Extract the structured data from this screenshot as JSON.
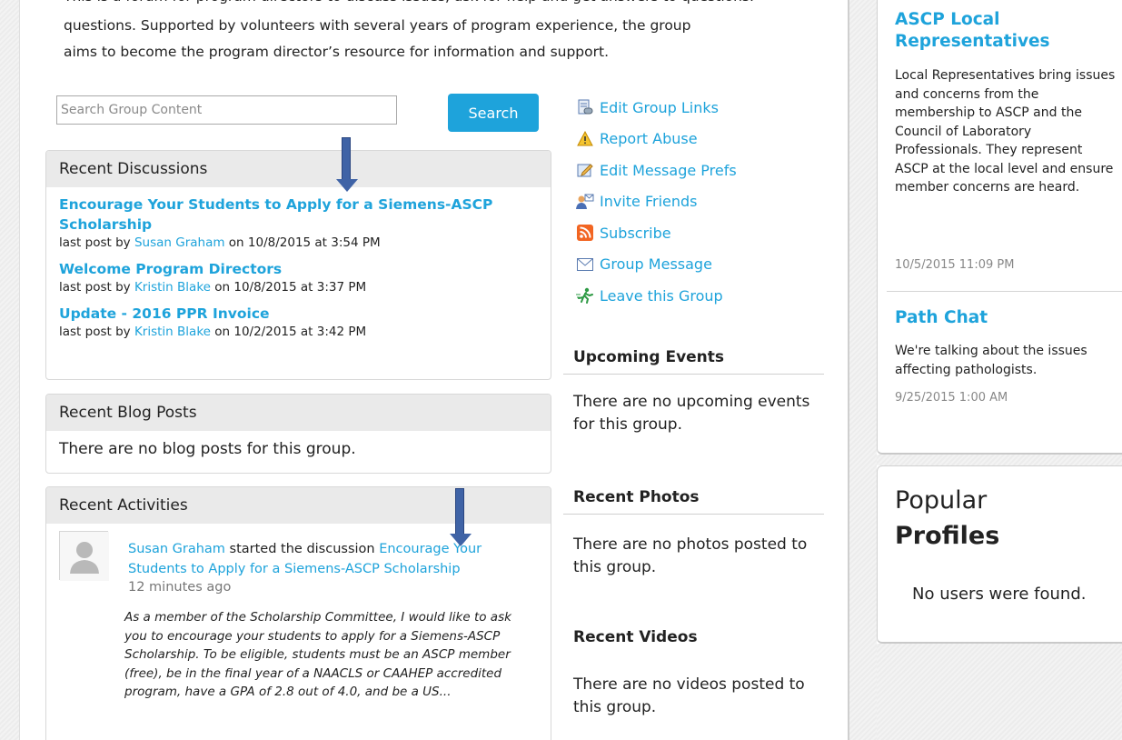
{
  "intro": {
    "clipped_line": "This is a forum for program directors to discuss issues, ask for help and get answers to questions.",
    "line1": "questions. Supported by volunteers with several years of program experience, the group",
    "line2": "aims to become the program director’s resource for information and support."
  },
  "search": {
    "placeholder": "Search Group Content",
    "button_label": "Search"
  },
  "discussions": {
    "title": "Recent Discussions",
    "items": [
      {
        "title": "Encourage Your Students to Apply for a Siemens-ASCP Scholarship",
        "prefix": "last post by ",
        "author": "Susan Graham",
        "suffix": " on 10/8/2015 at 3:54 PM"
      },
      {
        "title": "Welcome Program Directors",
        "prefix": "last post by ",
        "author": "Kristin Blake",
        "suffix": " on 10/8/2015 at 3:37 PM"
      },
      {
        "title": "Update - 2016 PPR Invoice",
        "prefix": "last post by ",
        "author": "Kristin Blake",
        "suffix": " on 10/2/2015 at 3:42 PM"
      }
    ]
  },
  "blog": {
    "title": "Recent Blog Posts",
    "empty": "There are no blog posts for this group."
  },
  "activities": {
    "title": "Recent Activities",
    "actor": "Susan Graham",
    "verb": " started the discussion ",
    "target": "Encourage Your Students to Apply for a Siemens-ASCP Scholarship",
    "time": "12 minutes ago",
    "quote": "As a member of the Scholarship Committee, I would like to ask you to encourage your students to apply for a Siemens-ASCP Scholarship. To be eligible, students must be an ASCP member (free), be in the final year of a NAACLS or CAAHEP accredited program, have a GPA of 2.8 out of 4.0, and be a US..."
  },
  "group_links": [
    {
      "label": "Edit Group Links",
      "icon": "edit-links-icon"
    },
    {
      "label": "Report Abuse",
      "icon": "warning-icon"
    },
    {
      "label": "Edit Message Prefs",
      "icon": "edit-prefs-icon"
    },
    {
      "label": "Invite Friends",
      "icon": "invite-friends-icon"
    },
    {
      "label": "Subscribe",
      "icon": "rss-icon"
    },
    {
      "label": "Group Message",
      "icon": "envelope-icon"
    },
    {
      "label": "Leave this Group",
      "icon": "leave-icon"
    }
  ],
  "events": {
    "title": "Upcoming Events",
    "empty": "There are no upcoming events for this group."
  },
  "photos": {
    "title": "Recent Photos",
    "empty": "There are no photos posted to this group."
  },
  "videos": {
    "title": "Recent Videos",
    "empty": "There are no videos posted to this group."
  },
  "right_items": [
    {
      "title": "ASCP Local Representatives",
      "desc": "Local Representatives bring issues and concerns from the membership to ASCP and the Council of Laboratory Professionals. They represent ASCP at the local level and ensure member concerns are heard.",
      "date": "10/5/2015 11:09 PM"
    },
    {
      "title": "Path Chat",
      "desc": "We're talking about the issues affecting pathologists.",
      "date": "9/25/2015 1:00 AM"
    }
  ],
  "popular": {
    "title_light": "Popular",
    "title_bold": "Profiles",
    "empty": "No users were found."
  },
  "colors": {
    "link": "#1ea3db",
    "arrow": "#3f63a6",
    "panel_header": "#eaeaea"
  }
}
